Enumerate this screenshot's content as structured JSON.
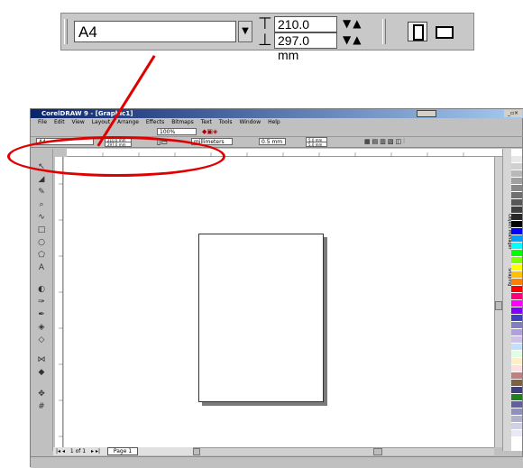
{
  "zoom_property_bar": {
    "paper_size": "A4",
    "width_value": "210.0 mm",
    "height_value": "297.0 mm",
    "spin_glyph": "▼▲",
    "dropdown_glyph": "▼"
  },
  "app": {
    "title": "CorelDRAW 9 - [Graphic1]",
    "menus": [
      "File",
      "Edit",
      "View",
      "Layout",
      "Arrange",
      "Effects",
      "Bitmaps",
      "Text",
      "Tools",
      "Window",
      "Help"
    ],
    "zoom_value": "100%",
    "propbar": {
      "paper_size": "A4",
      "width_value": "210.0 mm",
      "height_value": "297.0 mm",
      "units": "millimeters",
      "nudge": "0.5 mm",
      "dup_x": "5.0 mm",
      "dup_y": "5.0 mm"
    },
    "page_nav": {
      "position": "1 of 1",
      "tab_label": "Page 1"
    },
    "dockers": {
      "object_manager": "Object Manager",
      "shaping": "Shaping"
    },
    "palette_colors": [
      "#ffffff",
      "#e8e8e8",
      "#d0d0d0",
      "#b8b8b8",
      "#a0a0a0",
      "#888888",
      "#707070",
      "#585858",
      "#404040",
      "#282828",
      "#000000",
      "#0000ff",
      "#00a0ff",
      "#00ffff",
      "#00ff00",
      "#80ff00",
      "#ffff00",
      "#ffc000",
      "#ff8000",
      "#ff0000",
      "#ff0080",
      "#ff00ff",
      "#8000ff",
      "#4040c0",
      "#8080c0",
      "#b0a0e0",
      "#d0c0f0",
      "#c0e0ff",
      "#e0ffe0",
      "#fff0c0",
      "#ffe0e0",
      "#c08080",
      "#806040",
      "#404080",
      "#208020",
      "#6060a0",
      "#9090c0",
      "#b0b0d0",
      "#d0d0e8",
      "#e8e8f8"
    ]
  },
  "annotation": {
    "color": "#e00000"
  }
}
